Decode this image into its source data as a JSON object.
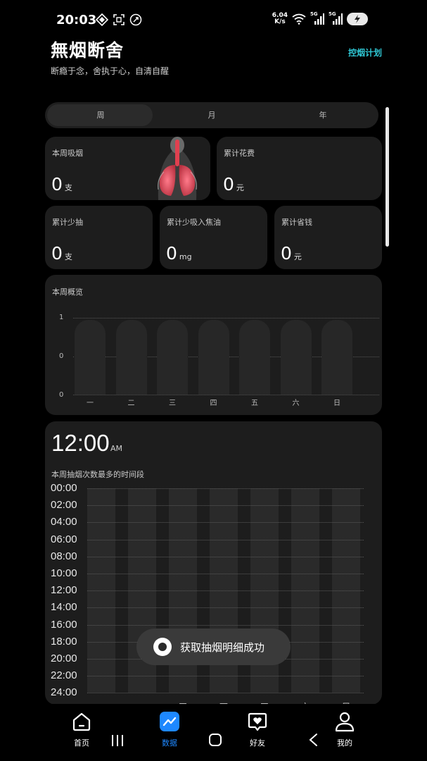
{
  "status_bar": {
    "time": "20:03",
    "speed_value": "6.04",
    "speed_unit": "K/s",
    "net1": "5G",
    "net2": "5G"
  },
  "header": {
    "title": "無烟断舍",
    "subtitle": "断瘾于念，舍执于心，自清自醒",
    "plan_link": "控烟计划"
  },
  "period_tabs": {
    "items": [
      "周",
      "月",
      "年"
    ],
    "selected": "周"
  },
  "stats": {
    "week_smoke": {
      "label": "本周吸烟",
      "value": "0",
      "unit": "支"
    },
    "total_cost": {
      "label": "累计花费",
      "value": "0",
      "unit": "元"
    },
    "less_smoked": {
      "label": "累计少抽",
      "value": "0",
      "unit": "支"
    },
    "less_tar": {
      "label": "累计少吸入焦油",
      "value": "0",
      "unit": "mg"
    },
    "money_saved": {
      "label": "累计省钱",
      "value": "0",
      "unit": "元"
    }
  },
  "chart_data": {
    "type": "bar",
    "title": "本周概览",
    "categories": [
      "一",
      "二",
      "三",
      "四",
      "五",
      "六",
      "日"
    ],
    "values": [
      0,
      0,
      0,
      0,
      0,
      0,
      0
    ],
    "y_ticks": [
      "1",
      "0",
      "0"
    ],
    "grid": true
  },
  "time_card": {
    "time": "12:00",
    "ampm": "AM",
    "subtitle": "本周抽烟次数最多的时间段",
    "hours": [
      "00:00",
      "02:00",
      "04:00",
      "06:00",
      "08:00",
      "10:00",
      "12:00",
      "14:00",
      "16:00",
      "18:00",
      "20:00",
      "22:00",
      "24:00"
    ],
    "days": [
      "一",
      "二",
      "三",
      "四",
      "五",
      "六",
      "日"
    ]
  },
  "toast": {
    "text": "获取抽烟明细成功"
  },
  "bottom_nav": {
    "items": [
      {
        "label": "首页",
        "icon": "home-icon"
      },
      {
        "label": "数据",
        "icon": "chart-icon"
      },
      {
        "label": "好友",
        "icon": "friends-icon"
      },
      {
        "label": "我的",
        "icon": "profile-icon"
      }
    ],
    "active": "数据"
  },
  "colors": {
    "accent": "#2fc6d3",
    "nav_active": "#1e88ff",
    "card_bg": "#1d1d1d"
  }
}
